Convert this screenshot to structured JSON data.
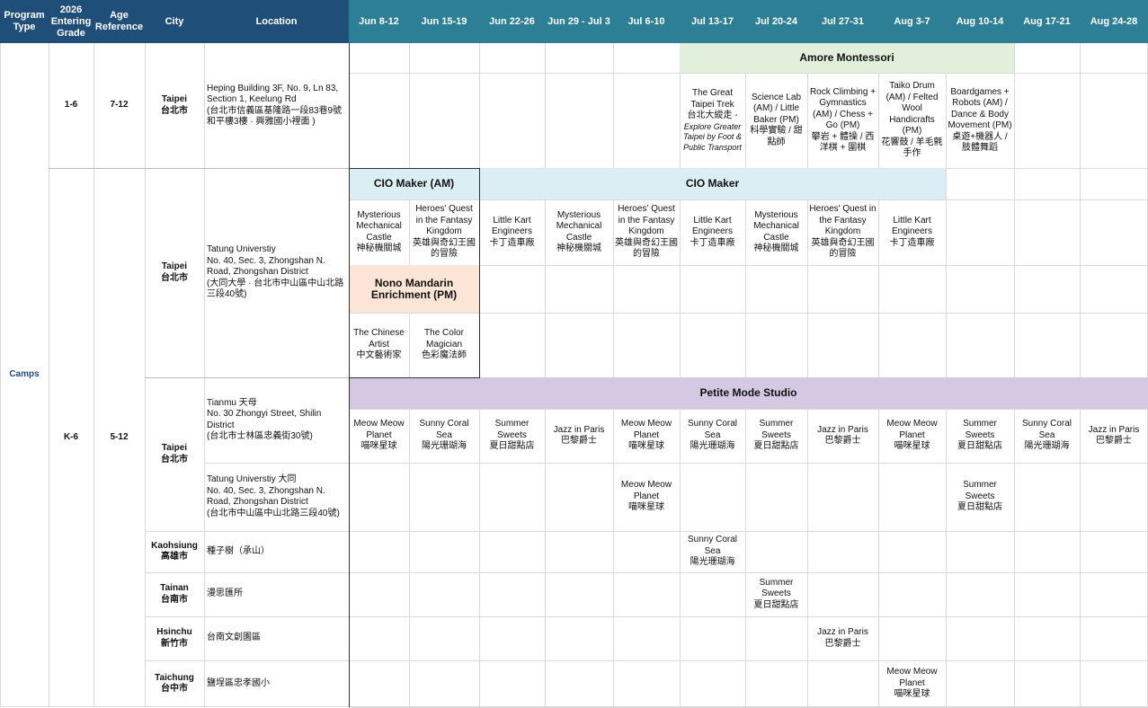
{
  "header": {
    "program_type": "Program Type",
    "entering_grade": "2026 Entering Grade",
    "age_reference": "Age Reference",
    "city": "City",
    "location": "Location",
    "weeks": [
      "Jun 8-12",
      "Jun 15-19",
      "Jun 22-26",
      "Jun 29 - Jul 3",
      "Jul 6-10",
      "Jul 13-17",
      "Jul 20-24",
      "Jul 27-31",
      "Aug 3-7",
      "Aug 10-14",
      "Aug 17-21",
      "Aug 24-28"
    ]
  },
  "program_type": "Camps",
  "groups": [
    {
      "grade": "1-6",
      "age": "7-12"
    },
    {
      "grade": "K-6",
      "age": "5-12"
    }
  ],
  "cities": {
    "taipei": "Taipei\n台北市",
    "kaohsiung": "Kaohsiung\n高雄市",
    "tainan": "Tainan\n台南市",
    "hsinchu": "Hsinchu\n新竹市",
    "taichung": "Taichung\n台中市"
  },
  "locations": {
    "heping": "Heping Building 3F, No. 9, Ln 83, Section 1, Keelung Rd\n(台北市信義區基隆路一段83巷9號和平樓3樓 · 興雅國小裡面 )",
    "tatung": "Tatung Universtiy\nNo. 40, Sec. 3, Zhongshan N. Road, Zhongshan District\n(大同大學 · 台北市中山區中山北路三段40號)",
    "tianmu": "Tianmu 天母\nNo. 30 Zhongyi Street, Shilin District\n(台北市士林區忠義街30號)",
    "tatung2": "Tatung Universtiy 大同\nNo. 40, Sec. 3, Zhongshan N. Road, Zhongshan District\n(台北市中山區中山北路三段40號)",
    "kaohsiung": "種子樹（承山）",
    "tainan": "漫思匯所",
    "hsinchu": "台南文創園區",
    "taichung": "鹽埕區忠孝國小"
  },
  "programs": {
    "amore": "Amore Montessori",
    "cio_am": "CIO Maker (AM)",
    "cio": "CIO Maker",
    "nono": "Nono Mandarin Enrichment (PM)",
    "petite": "Petite Mode Studio"
  },
  "amore_cells": [
    {
      "week": 5,
      "text": "The Great Taipei Trek\n台北大縱走 -",
      "sub": "Explore Greater Taipei by Foot & Public Transport"
    },
    {
      "week": 6,
      "text": "Science Lab (AM) / Little Baker (PM)\n科學實驗 / 甜點師"
    },
    {
      "week": 7,
      "text": "Rock Climbing + Gymnastics (AM) / Chess + Go (PM)\n攀岩 + 體操 / 西洋棋 + 圍棋"
    },
    {
      "week": 8,
      "text": "Taiko Drum (AM) / Felted Wool Handicrafts (PM)\n花響鼓 / 羊毛氈手作"
    },
    {
      "week": 9,
      "text": "Boardgames + Robots (AM) / Dance & Body Movement (PM)\n桌遊+機器人 / 肢體舞蹈"
    }
  ],
  "cio_cells": [
    "Mysterious Mechanical Castle\n神秘機關城",
    "Heroes' Quest in the Fantasy Kingdom\n英雄與奇幻王國的冒險",
    "Little Kart Engineers\n卡丁造車廠",
    "Mysterious Mechanical Castle\n神秘機關城",
    "Heroes' Quest in the Fantasy Kingdom\n英雄與奇幻王國的冒險",
    "Little Kart Engineers\n卡丁造車廠",
    "Mysterious Mechanical Castle\n神秘機關城",
    "Heroes' Quest in the Fantasy Kingdom\n英雄與奇幻王國的冒險",
    "Little Kart Engineers\n卡丁造車廠"
  ],
  "nono_cells": [
    "The Chinese Artist\n中文藝術家",
    "The Color Magician\n色彩魔法師"
  ],
  "petite_cells": [
    "Meow Meow Planet\n喵咪星球",
    "Sunny Coral Sea\n陽光珊瑚海",
    "Summer Sweets\n夏日甜點店",
    "Jazz in Paris\n巴黎爵士",
    "Meow Meow Planet\n喵咪星球",
    "Sunny Coral Sea\n陽光珊瑚海",
    "Summer Sweets\n夏日甜點店",
    "Jazz in Paris\n巴黎爵士",
    "Meow Meow Planet\n喵咪星球",
    "Summer Sweets\n夏日甜點店",
    "Sunny Coral Sea\n陽光珊瑚海",
    "Jazz in Paris\n巴黎爵士"
  ],
  "tatung2_cells": [
    {
      "week": 4,
      "text": "Meow Meow Planet\n喵咪星球"
    },
    {
      "week": 9,
      "text": "Summer Sweets\n夏日甜點店"
    }
  ],
  "kaohsiung_cells": [
    {
      "week": 5,
      "text": "Sunny Coral Sea\n陽光珊瑚海"
    }
  ],
  "tainan_cells": [
    {
      "week": 6,
      "text": "Summer Sweets\n夏日甜點店"
    }
  ],
  "hsinchu_cells": [
    {
      "week": 7,
      "text": "Jazz in Paris\n巴黎爵士"
    }
  ],
  "taichung_cells": [
    {
      "week": 8,
      "text": "Meow Meow Planet\n喵咪星球"
    }
  ],
  "colors": {
    "header_left": "#1f4e79",
    "header_weeks": "#2d7f96",
    "amore": "#e2efda",
    "cio": "#daeef3",
    "nono": "#fce4d6",
    "petite": "#d5c8e3",
    "grid": "#d9d9d9",
    "camps_text": "#1f4e79"
  }
}
